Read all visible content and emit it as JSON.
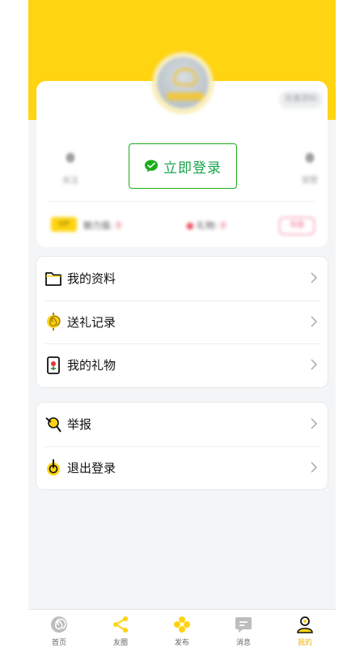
{
  "profile": {
    "edit_label": "完善资料",
    "stats": [
      {
        "value": "0",
        "label": "关注"
      },
      {
        "value": "0",
        "label": "获赞"
      }
    ],
    "login_label": "立即登录",
    "vip_label": "VIP",
    "charm_label": "魅力值:",
    "charm_value": "0",
    "gift_label": "礼物:",
    "gift_value": "0",
    "action_label": "充值"
  },
  "menu_primary": [
    {
      "label": "我的资料",
      "icon": "folder-icon"
    },
    {
      "label": "送礼记录",
      "icon": "spiral-icon"
    },
    {
      "label": "我的礼物",
      "icon": "gift-card-icon"
    }
  ],
  "menu_secondary": [
    {
      "label": "举报",
      "icon": "report-icon"
    },
    {
      "label": "退出登录",
      "icon": "logout-icon"
    }
  ],
  "tabs": [
    {
      "label": "首页",
      "icon": "home-spiral-icon"
    },
    {
      "label": "友圈",
      "icon": "share-icon"
    },
    {
      "label": "发布",
      "icon": "publish-icon"
    },
    {
      "label": "消息",
      "icon": "message-icon"
    },
    {
      "label": "我的",
      "icon": "profile-icon",
      "active": true
    }
  ],
  "colors": {
    "accent_yellow": "#ffd410",
    "wechat_green": "#1aad19",
    "background": "#f4f5f7"
  }
}
